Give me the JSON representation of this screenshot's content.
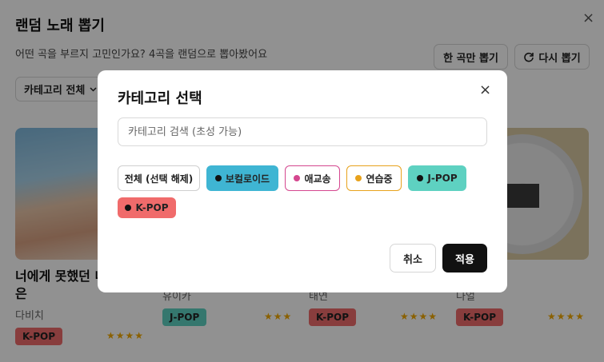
{
  "page": {
    "title": "랜덤 노래 뽑기",
    "close_icon": "×",
    "subtitle": "어떤 곡을 부르지 고민인가요? 4곡을 랜덤으로 뽑아봤어요",
    "one_song_button": "한 곡만 뽑기",
    "redraw_button": "다시 뽑기",
    "category_select": "카테고리 전체"
  },
  "songs": [
    {
      "title_line1": "너에게 못했던 내",
      "title_line2": "은",
      "artist": "다비치",
      "tag": "K-POP",
      "stars": "★★★★"
    },
    {
      "artist": "유이카",
      "tag": "J-POP",
      "stars": "★★★"
    },
    {
      "artist": "태연",
      "tag": "K-POP",
      "stars": "★★★★"
    },
    {
      "artist": "나얼",
      "tag": "K-POP",
      "stars": "★★★★"
    }
  ],
  "modal": {
    "title": "카테고리 선택",
    "close_icon": "×",
    "search_placeholder": "카테고리 검색 (초성 가능)",
    "chips": {
      "all": "전체 (선택 해제)",
      "vocaloid": "보컬로이드",
      "aegyo": "애교송",
      "practice": "연습중",
      "jpop": "J-POP",
      "kpop": "K-POP"
    },
    "chip_colors": {
      "vocaloid": "#3fb5d3",
      "aegyo": "#d5478f",
      "practice": "#e8a21c",
      "jpop": "#5ed1c1",
      "kpop": "#f06b6b"
    },
    "cancel_button": "취소",
    "apply_button": "적용"
  }
}
